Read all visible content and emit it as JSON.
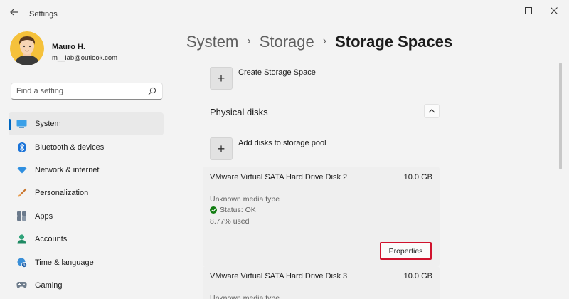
{
  "window": {
    "title": "Settings",
    "icons": {
      "back": "back-arrow-icon",
      "minimize": "minimize-icon",
      "maximize": "maximize-icon",
      "close": "close-icon"
    }
  },
  "user": {
    "name": "Mauro H.",
    "email": "m__lab@outlook.com"
  },
  "search": {
    "placeholder": "Find a setting",
    "value": "",
    "icon": "search-icon"
  },
  "sidebar": {
    "items": [
      {
        "label": "System",
        "icon": "monitor-icon",
        "active": true
      },
      {
        "label": "Bluetooth & devices",
        "icon": "bluetooth-icon"
      },
      {
        "label": "Network & internet",
        "icon": "wifi-icon"
      },
      {
        "label": "Personalization",
        "icon": "brush-icon"
      },
      {
        "label": "Apps",
        "icon": "apps-icon"
      },
      {
        "label": "Accounts",
        "icon": "person-icon"
      },
      {
        "label": "Time & language",
        "icon": "globe-clock-icon"
      },
      {
        "label": "Gaming",
        "icon": "gamepad-icon"
      }
    ]
  },
  "breadcrumb": {
    "items": [
      "System",
      "Storage"
    ],
    "separator": "›",
    "current": "Storage Spaces"
  },
  "main": {
    "create_storage_space": "Create Storage Space",
    "plus_glyph": "+",
    "physical_disks_title": "Physical disks",
    "add_disks": "Add disks to storage pool",
    "disks": [
      {
        "name": "VMware Virtual SATA Hard Drive Disk 2",
        "size": "10.0 GB",
        "media_type": "Unknown media type",
        "status": "Status: OK",
        "used": "8.77% used",
        "properties_label": "Properties"
      },
      {
        "name": "VMware Virtual SATA Hard Drive Disk 3",
        "size": "10.0 GB",
        "media_type": "Unknown media type"
      }
    ]
  },
  "colors": {
    "accent": "#0067c0",
    "highlight_border": "#d0122d",
    "status_ok": "#107c10",
    "window_bg": "#f3f3f3"
  }
}
